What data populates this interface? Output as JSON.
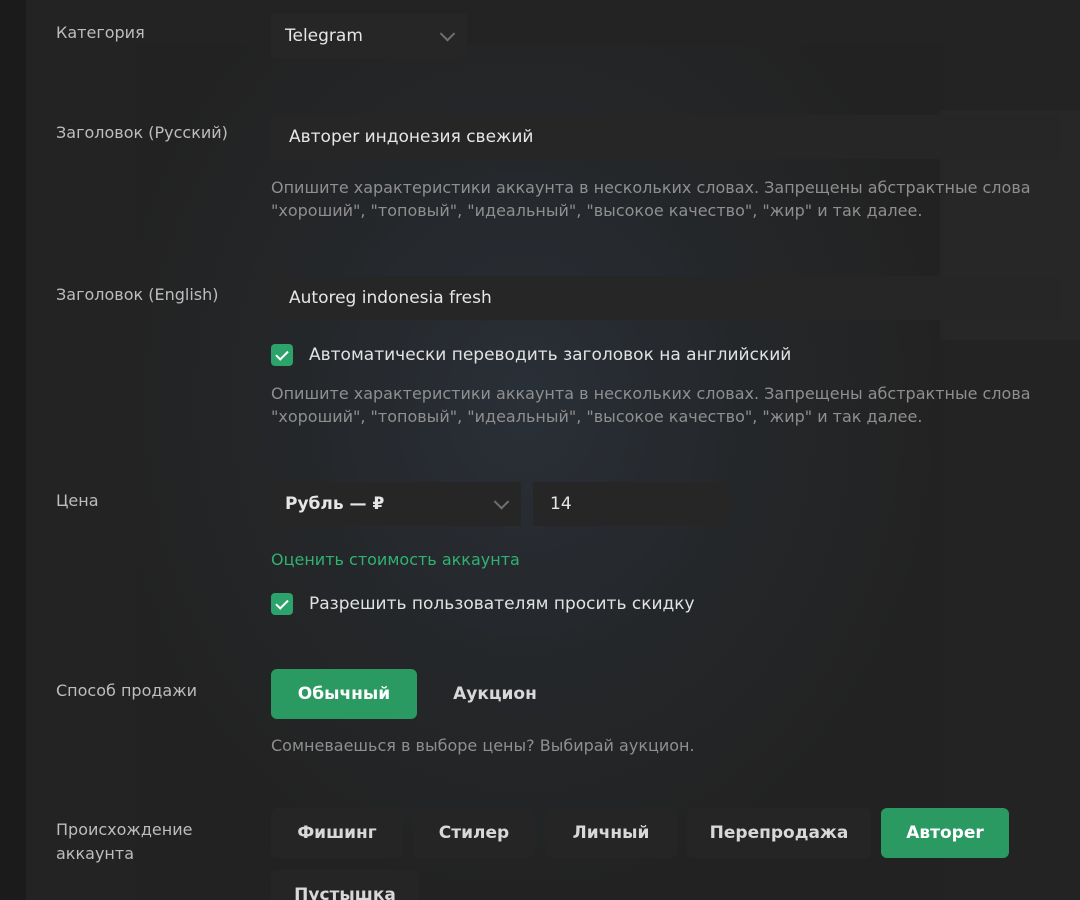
{
  "category": {
    "label": "Категория",
    "value": "Telegram"
  },
  "title_ru": {
    "label": "Заголовок (Русский)",
    "value": "Автореr индонезия свежий",
    "hint_line1": "Опишите характеристики аккаунта в нескольких словах. Запрещены абстрактные слова",
    "hint_line2": "\"хороший\", \"топовый\", \"идеальный\", \"высокое качество\", \"жир\" и так далее."
  },
  "title_en": {
    "label": "Заголовок (English)",
    "value": "Autoreg indonesia fresh",
    "auto_translate_label": "Автоматически переводить заголовок на английский",
    "hint_line1": "Опишите характеристики аккаунта в нескольких словах. Запрещены абстрактные слова",
    "hint_line2": "\"хороший\", \"топовый\", \"идеальный\", \"высокое качество\", \"жир\" и так далее."
  },
  "price": {
    "label": "Цена",
    "currency": "Рубль — ₽",
    "amount": "14",
    "estimate_link": "Оценить стоимость аккаунта",
    "allow_discount_label": "Разрешить пользователям просить скидку"
  },
  "sale_method": {
    "label": "Способ продажи",
    "options": [
      "Обычный",
      "Аукцион"
    ],
    "selected": "Обычный",
    "hint": "Сомневаешься в выборе цены? Выбирай аукцион."
  },
  "origin": {
    "label_line1": "Происхождение",
    "label_line2": "аккаунта",
    "options": [
      "Фишинг",
      "Стилер",
      "Личный",
      "Перепродажа",
      "Автореr",
      "Пустышка"
    ],
    "selected": "Автореr"
  },
  "colors": {
    "accent": "#2b9a62",
    "link": "#2fb271",
    "background": "#232323",
    "field": "#262626"
  }
}
